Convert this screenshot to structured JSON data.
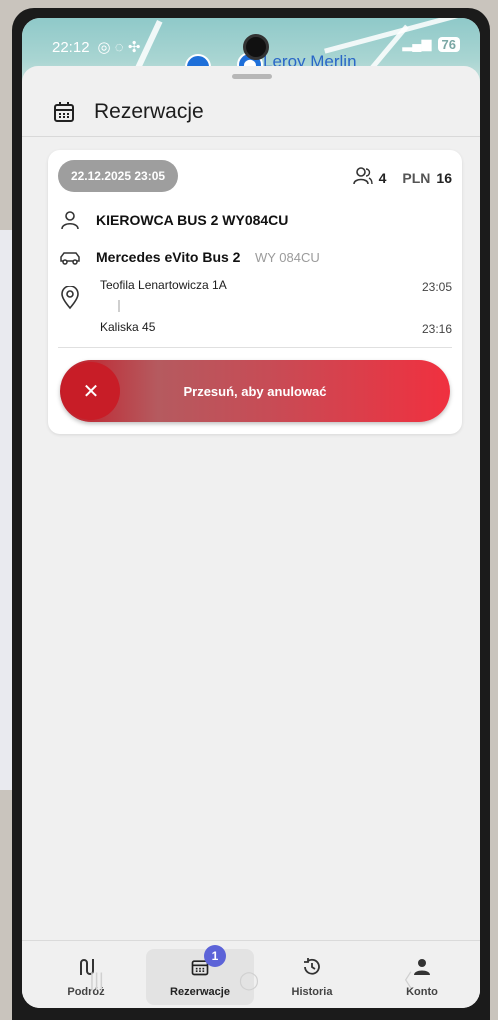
{
  "status_bar": {
    "time": "22:12",
    "battery": "76"
  },
  "map": {
    "place_label": "Leroy Merlin"
  },
  "header": {
    "title": "Rezerwacje"
  },
  "reservation": {
    "datetime": "22.12.2025 23:05",
    "passengers": "4",
    "currency": "PLN",
    "price": "16",
    "driver": "KIEROWCA BUS 2 WY084CU",
    "vehicle": "Mercedes eVito Bus 2",
    "plate": "WY 084CU",
    "pickup": {
      "address": "Teofila Lenartowicza 1A",
      "time": "23:05"
    },
    "dropoff": {
      "address": "Kaliska 45",
      "time": "23:16"
    },
    "cancel_slider_label": "Przesuń, aby anulować"
  },
  "nav": {
    "items": [
      {
        "label": "Podróż",
        "icon": "route-icon"
      },
      {
        "label": "Rezerwacje",
        "icon": "calendar-icon",
        "badge": "1"
      },
      {
        "label": "Historia",
        "icon": "history-icon"
      },
      {
        "label": "Konto",
        "icon": "person-icon"
      }
    ]
  },
  "colors": {
    "accent_red": "#e0303f",
    "badge": "#5c63d8",
    "pill": "#9e9e9e"
  }
}
